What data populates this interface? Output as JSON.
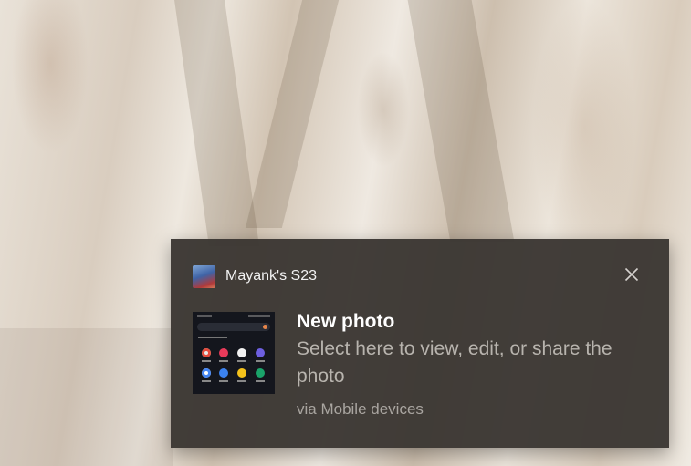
{
  "notification": {
    "app_name": "Mayank's S23",
    "app_icon": "device-avatar-image",
    "close_icon": "close-icon",
    "title": "New photo",
    "body": "Select here to view, edit, or share the photo",
    "attribution": "via Mobile devices",
    "thumbnail": "phone-screenshot-thumbnail"
  },
  "colors": {
    "toast_background": "#3a3632",
    "title_text": "#ffffff",
    "body_text": "#b8b4ae"
  }
}
